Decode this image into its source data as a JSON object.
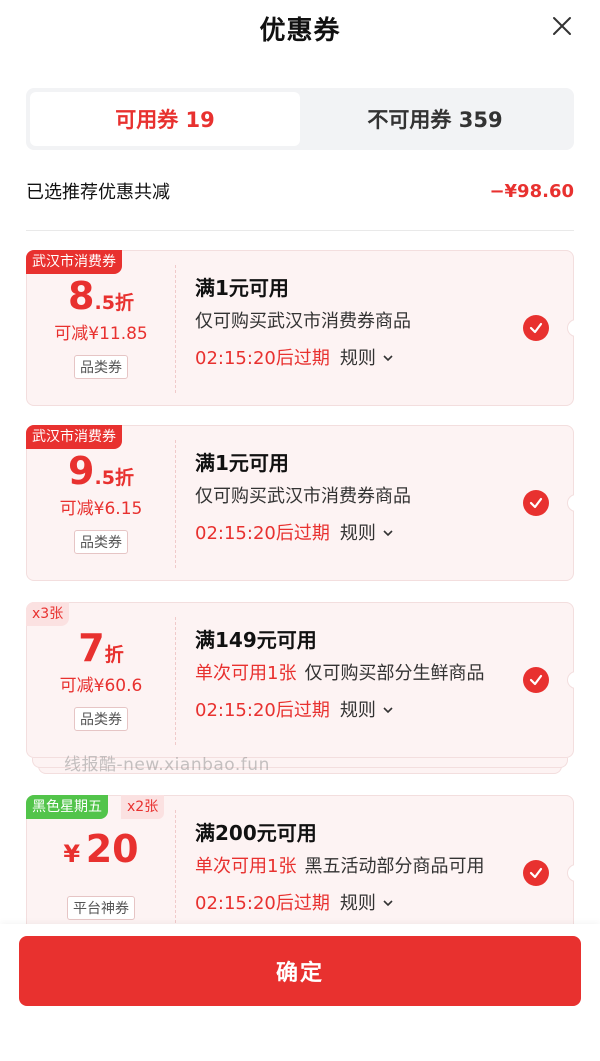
{
  "header": {
    "title": "优惠券"
  },
  "tabs": [
    {
      "label": "可用券 19",
      "active": true
    },
    {
      "label": "不可用券 359",
      "active": false
    }
  ],
  "summary": {
    "label": "已选推荐优惠共减",
    "amount": "−¥98.60"
  },
  "coupons": [
    {
      "tag": "武汉市消费券",
      "tag2": "",
      "discount_big": "8",
      "discount_small": ".5折",
      "save": "可减¥11.85",
      "type": "品类券",
      "condition": "满1元可用",
      "desc_highlight": "",
      "desc": "仅可购买武汉市消费券商品",
      "expire": "02:15:20后过期",
      "rule": "规则",
      "selected": true
    },
    {
      "tag": "武汉市消费券",
      "tag2": "",
      "discount_big": "9",
      "discount_small": ".5折",
      "save": "可减¥6.15",
      "type": "品类券",
      "condition": "满1元可用",
      "desc_highlight": "",
      "desc": "仅可购买武汉市消费券商品",
      "expire": "02:15:20后过期",
      "rule": "规则",
      "selected": true
    },
    {
      "tag": "x3张",
      "tag2": "",
      "discount_big": "7",
      "discount_small": "折",
      "save": "可减¥60.6",
      "type": "品类券",
      "condition": "满149元可用",
      "desc_highlight": "单次可用1张",
      "desc": "仅可购买部分生鲜商品",
      "expire": "02:15:20后过期",
      "rule": "规则",
      "selected": true
    },
    {
      "tag": "黑色星期五",
      "tag2": "x2张",
      "discount_yen": "¥",
      "discount_big": "20",
      "save": "",
      "type": "平台神券",
      "condition": "满200元可用",
      "desc_highlight": "单次可用1张",
      "desc": "黑五活动部分商品可用",
      "expire": "02:15:20后过期",
      "rule": "规则",
      "selected": true
    }
  ],
  "watermark": "线报酷-new.xianbao.fun",
  "footer": {
    "confirm_label": "确定"
  },
  "colors": {
    "accent": "#e8312f",
    "card_bg": "#fdf3f3",
    "green_tag": "#52c44a"
  }
}
